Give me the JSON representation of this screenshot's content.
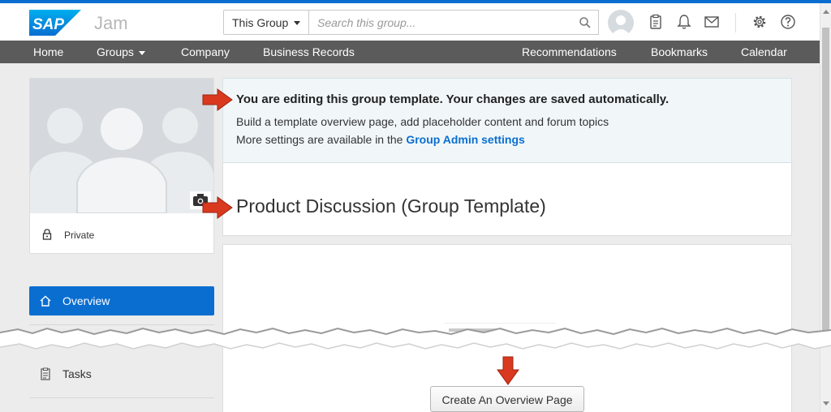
{
  "header": {
    "logo_text": "SAP",
    "product_name": "Jam",
    "scope": "This Group",
    "search_placeholder": "Search this group...",
    "icons": [
      "user-avatar",
      "clipboard-icon",
      "bell-icon",
      "mail-icon",
      "gear-icon",
      "help-icon"
    ]
  },
  "nav": {
    "left": [
      "Home",
      "Groups",
      "Company",
      "Business Records"
    ],
    "right": [
      "Recommendations",
      "Bookmarks",
      "Calendar"
    ]
  },
  "sidebar": {
    "privacy": "Private",
    "items": [
      {
        "label": "Overview",
        "icon": "home-icon",
        "active": true
      },
      {
        "label": "Tasks",
        "icon": "clipboard-icon",
        "active": false
      }
    ]
  },
  "banner": {
    "title": "You are editing this group template. Your changes are saved automatically.",
    "line1": "Build a template overview page, add placeholder content and forum topics",
    "line2_prefix": "More settings are available in the",
    "line2_link": "Group Admin settings"
  },
  "group": {
    "title": "Product Discussion (Group Template)"
  },
  "content": {
    "create_button": "Create An Overview Page"
  },
  "colors": {
    "accent": "#0a6ed1",
    "nav_bg": "#5b5b5b",
    "banner_bg": "#f1f7f9",
    "annotation_arrow": "#d9391f"
  }
}
